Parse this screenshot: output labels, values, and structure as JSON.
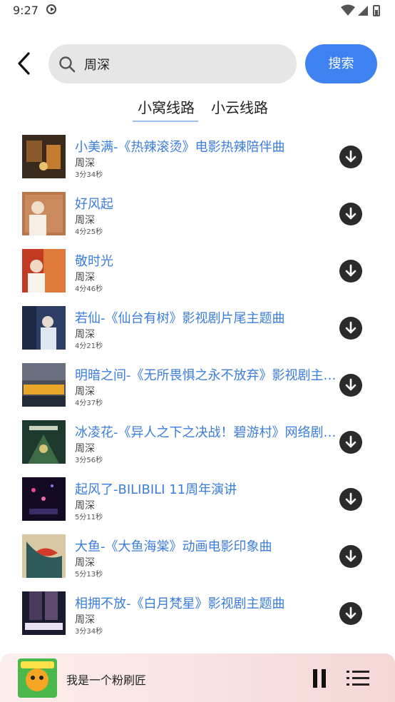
{
  "status": {
    "time": "9:27"
  },
  "search": {
    "value": "周深",
    "button_label": "搜索"
  },
  "tabs": [
    {
      "label": "小窝线路",
      "active": true
    },
    {
      "label": "小云线路",
      "active": false
    }
  ],
  "songs": [
    {
      "title": "小美满-《热辣滚烫》电影热辣陪伴曲",
      "artist": "周深",
      "duration": "3分34秒"
    },
    {
      "title": "好风起",
      "artist": "周深",
      "duration": "4分25秒"
    },
    {
      "title": "敬时光",
      "artist": "周深",
      "duration": "4分46秒"
    },
    {
      "title": "若仙-《仙台有树》影视剧片尾主题曲",
      "artist": "周深",
      "duration": "4分21秒"
    },
    {
      "title": "明暗之间-《无所畏惧之永不放弃》影视剧主题曲",
      "artist": "周深",
      "duration": "4分37秒"
    },
    {
      "title": "冰凌花-《异人之下之决战！碧游村》网络剧主题曲",
      "artist": "周深",
      "duration": "3分56秒"
    },
    {
      "title": "起风了-BILIBILI 11周年演讲",
      "artist": "周深",
      "duration": "5分11秒"
    },
    {
      "title": "大鱼-《大鱼海棠》动画电影印象曲",
      "artist": "周深",
      "duration": "5分13秒"
    },
    {
      "title": "相拥不放-《白月梵星》影视剧主题曲",
      "artist": "周深",
      "duration": "3分34秒"
    }
  ],
  "player": {
    "title": "我是一个粉刷匠"
  },
  "colors": {
    "accent": "#3d82f0",
    "link": "#3b7ddb"
  }
}
